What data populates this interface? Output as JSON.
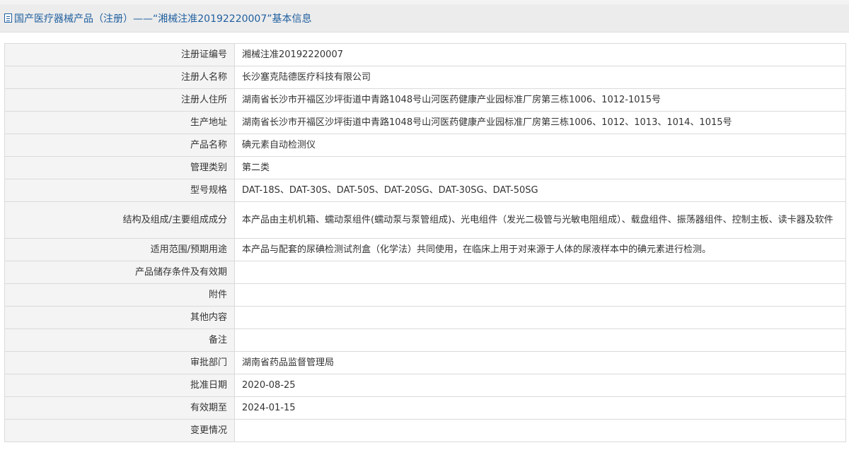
{
  "header": {
    "icon": "document-icon",
    "title": "国产医疗器械产品（注册）——“湘械注准20192220007”基本信息"
  },
  "rows": [
    {
      "label": "注册证编号",
      "value": "湘械注准20192220007"
    },
    {
      "label": "注册人名称",
      "value": "长沙塞克陆德医疗科技有限公司"
    },
    {
      "label": "注册人住所",
      "value": "湖南省长沙市开福区沙坪街道中青路1048号山河医药健康产业园标准厂房第三栋1006、1012-1015号"
    },
    {
      "label": "生产地址",
      "value": "湖南省长沙市开福区沙坪街道中青路1048号山河医药健康产业园标准厂房第三栋1006、1012、1013、1014、1015号"
    },
    {
      "label": "产品名称",
      "value": "碘元素自动检测仪"
    },
    {
      "label": "管理类别",
      "value": "第二类"
    },
    {
      "label": "型号规格",
      "value": "DAT-18S、DAT-30S、DAT-50S、DAT-20SG、DAT-30SG、DAT-50SG"
    },
    {
      "label": "结构及组成/主要组成成分",
      "value": "本产品由主机机箱、蠕动泵组件(蠕动泵与泵管组成)、光电组件（发光二极管与光敏电阻组成）、载盘组件、振荡器组件、控制主板、读卡器及软件"
    },
    {
      "label": "适用范围/预期用途",
      "value": "本产品与配套的尿碘检测试剂盒（化学法）共同使用，在临床上用于对来源于人体的尿液样本中的碘元素进行检测。"
    },
    {
      "label": "产品储存条件及有效期",
      "value": ""
    },
    {
      "label": "附件",
      "value": ""
    },
    {
      "label": "其他内容",
      "value": ""
    },
    {
      "label": "备注",
      "value": ""
    },
    {
      "label": "审批部门",
      "value": "湖南省药品监督管理局"
    },
    {
      "label": "批准日期",
      "value": "2020-08-25"
    },
    {
      "label": "有效期至",
      "value": "2024-01-15"
    },
    {
      "label": "变更情况",
      "value": ""
    }
  ]
}
